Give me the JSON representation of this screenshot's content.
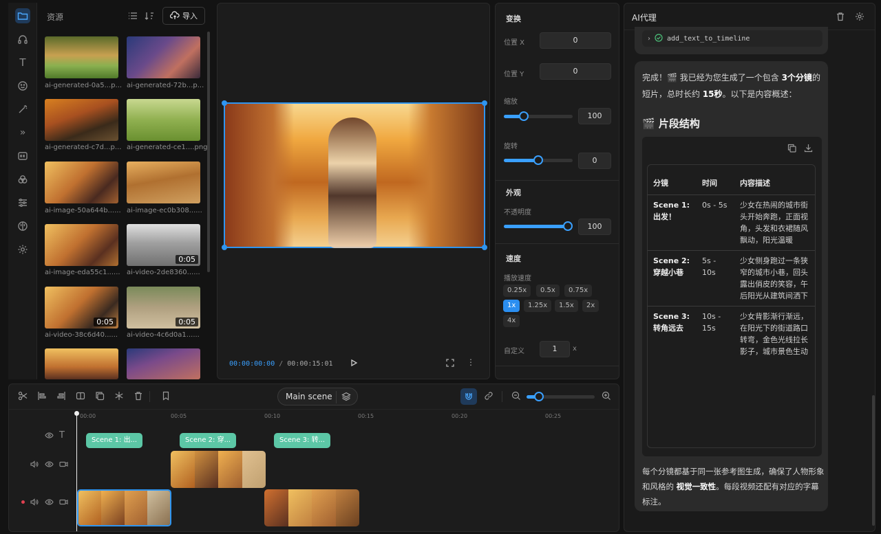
{
  "assets": {
    "title": "资源",
    "import_label": "导入",
    "items": [
      {
        "name": "ai-generated-0a5...p...",
        "duration": ""
      },
      {
        "name": "ai-generated-72b...p...",
        "duration": ""
      },
      {
        "name": "ai-generated-c7d...p...",
        "duration": ""
      },
      {
        "name": "ai-generated-ce1....png",
        "duration": ""
      },
      {
        "name": "ai-image-50a644b......",
        "duration": ""
      },
      {
        "name": "ai-image-ec0b308......",
        "duration": ""
      },
      {
        "name": "ai-image-eda55c1......",
        "duration": ""
      },
      {
        "name": "ai-video-2de8360......",
        "duration": "0:05"
      },
      {
        "name": "ai-video-38c6d40......",
        "duration": "0:05"
      },
      {
        "name": "ai-video-4c6d0a1......",
        "duration": "0:05"
      }
    ]
  },
  "preview": {
    "current_time": "00:00:00:00",
    "separator": "/",
    "total_time": "00:00:15:01"
  },
  "properties": {
    "transform_title": "变换",
    "pos_x_label": "位置 X",
    "pos_x": "0",
    "pos_y_label": "位置 Y",
    "pos_y": "0",
    "scale_label": "缩放",
    "scale": "100",
    "scale_level": 0.29,
    "rotate_label": "旋转",
    "rotate": "0",
    "rotate_level": 0.5,
    "appearance_title": "外观",
    "opacity_label": "不透明度",
    "opacity": "100",
    "opacity_level": 1.0,
    "speed_title": "速度",
    "playback_label": "播放速度",
    "speeds": [
      "0.25x",
      "0.5x",
      "0.75x",
      "1x",
      "1.25x",
      "1.5x",
      "2x",
      "4x"
    ],
    "selected_speed": "1x",
    "custom_label": "自定义",
    "custom_value": "1",
    "custom_unit": "x"
  },
  "ai_panel": {
    "title": "AI代理",
    "tool_call": "add_text_to_timeline",
    "message_intro_1": "完成！🎬 我已经为您生成了一个包含 ",
    "message_bold_1": "3个分镜",
    "message_intro_2": "的短片，总时长约 ",
    "message_bold_2": "15秒",
    "message_intro_3": "。以下是内容概述：",
    "section_title": "🎬 片段结构",
    "table_headers": [
      "分镜",
      "时间",
      "内容描述"
    ],
    "table_rows": [
      [
        "Scene 1: 出发！",
        "0s - 5s",
        "少女在热闹的城市街头开始奔跑，正面视角，头发和衣裙随风飘动，阳光温暖"
      ],
      [
        "Scene 2: 穿越小巷",
        "5s - 10s",
        "少女侧身跑过一条狭窄的城市小巷，回头露出俏皮的笑容，午后阳光从建筑间洒下"
      ],
      [
        "Scene 3: 转角远去",
        "10s - 15s",
        "少女背影渐行渐远，在阳光下的街道路口转弯，金色光线拉长影子，城市景色生动"
      ]
    ],
    "footer_1": "每个分镜都基于同一张参考图生成，确保了人物形象和风格的 ",
    "footer_bold": "视觉一致性",
    "footer_2": "。每段视频还配有对应的字幕标注。"
  },
  "timeline": {
    "scene_button": "Main scene",
    "ruler": [
      "00:00",
      "00:05",
      "00:10",
      "00:15",
      "00:20",
      "00:25"
    ],
    "text_clips": [
      "Scene 1: 出...",
      "Scene 2: 穿...",
      "Scene 3: 转..."
    ],
    "zoom_level": 0.18
  },
  "colors": {
    "accent": "#3aa0ff",
    "text_clip": "#5cc7a6",
    "background": "#131313"
  }
}
